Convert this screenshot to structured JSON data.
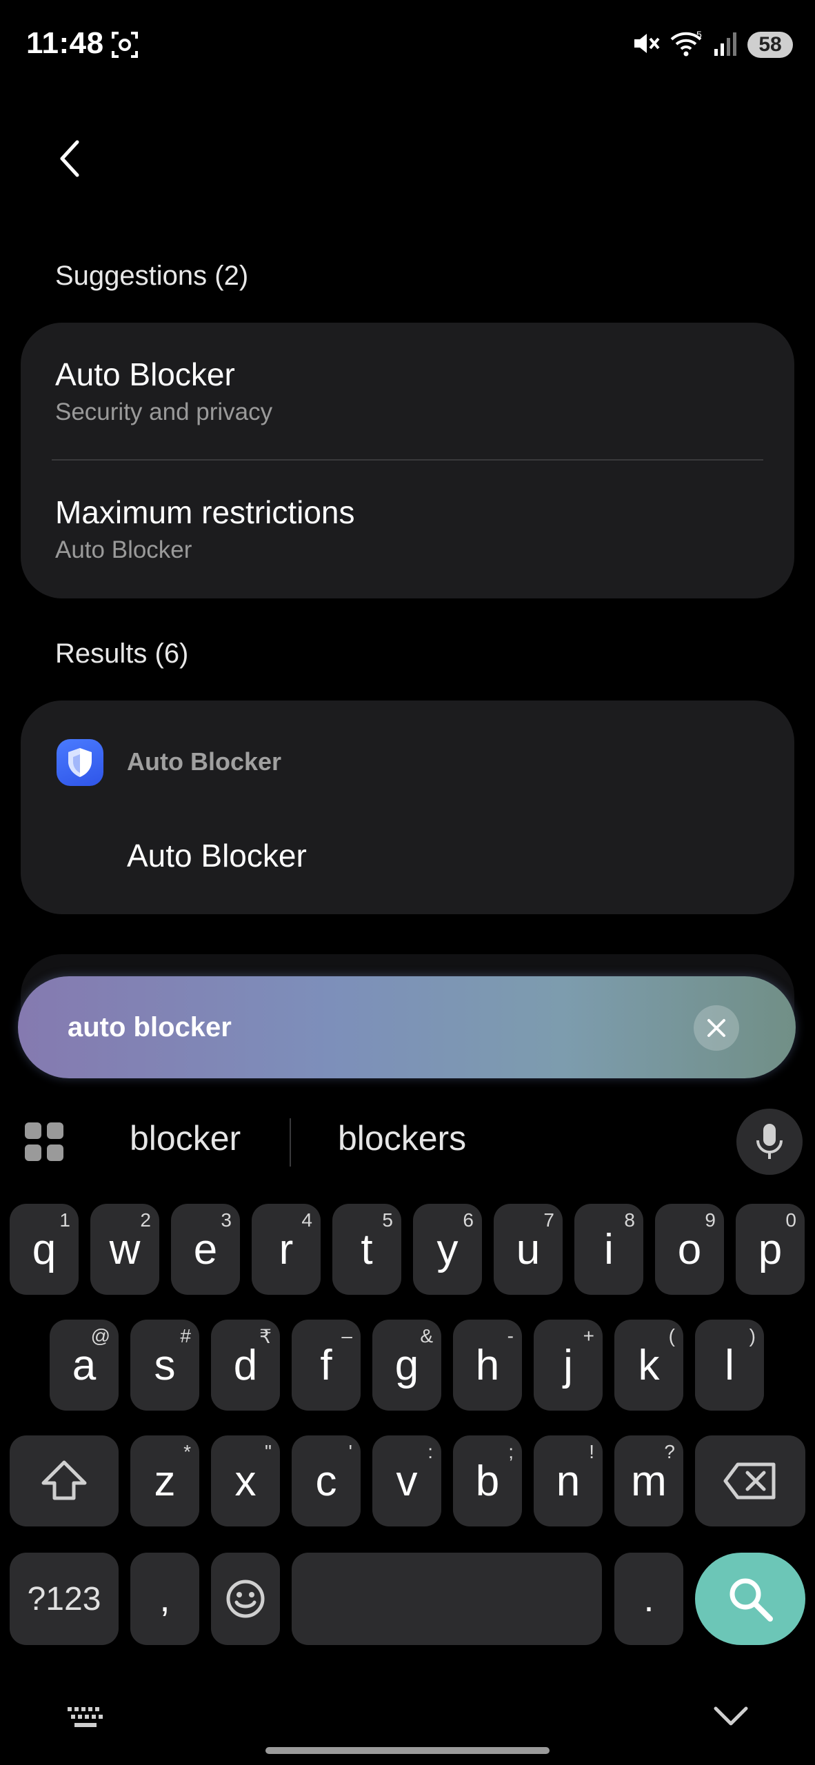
{
  "status_bar": {
    "time": "11:48",
    "battery": "58",
    "icons": [
      "screen-recorder-icon",
      "mute-icon",
      "wifi-icon",
      "signal-icon"
    ]
  },
  "suggestions": {
    "header": "Suggestions (2)",
    "items": [
      {
        "title": "Auto Blocker",
        "subtitle": "Security and privacy"
      },
      {
        "title": "Maximum restrictions",
        "subtitle": "Auto Blocker"
      }
    ]
  },
  "results": {
    "header": "Results (6)",
    "group": {
      "app_name": "Auto Blocker",
      "icon": "shield-icon",
      "items": [
        {
          "title": "Auto Blocker"
        }
      ]
    }
  },
  "search": {
    "query": "auto blocker"
  },
  "keyboard": {
    "suggestions": [
      "blocker",
      "blockers"
    ],
    "row1": [
      {
        "k": "q",
        "h": "1"
      },
      {
        "k": "w",
        "h": "2"
      },
      {
        "k": "e",
        "h": "3"
      },
      {
        "k": "r",
        "h": "4"
      },
      {
        "k": "t",
        "h": "5"
      },
      {
        "k": "y",
        "h": "6"
      },
      {
        "k": "u",
        "h": "7"
      },
      {
        "k": "i",
        "h": "8"
      },
      {
        "k": "o",
        "h": "9"
      },
      {
        "k": "p",
        "h": "0"
      }
    ],
    "row2": [
      {
        "k": "a",
        "h": "@"
      },
      {
        "k": "s",
        "h": "#"
      },
      {
        "k": "d",
        "h": "₹"
      },
      {
        "k": "f",
        "h": "–"
      },
      {
        "k": "g",
        "h": "&"
      },
      {
        "k": "h",
        "h": "-"
      },
      {
        "k": "j",
        "h": "+"
      },
      {
        "k": "k",
        "h": "("
      },
      {
        "k": "l",
        "h": ")"
      }
    ],
    "row3": [
      {
        "k": "z",
        "h": "*"
      },
      {
        "k": "x",
        "h": "\""
      },
      {
        "k": "c",
        "h": "'"
      },
      {
        "k": "v",
        "h": ":"
      },
      {
        "k": "b",
        "h": ";"
      },
      {
        "k": "n",
        "h": "!"
      },
      {
        "k": "m",
        "h": "?"
      }
    ],
    "symbols_label": "?123",
    "comma": ",",
    "period": "."
  },
  "colors": {
    "background": "#000000",
    "card": "#1c1c1e",
    "key": "#2c2c2e",
    "search_key": "#6cc6b7",
    "app_icon": "#3b63f2"
  }
}
